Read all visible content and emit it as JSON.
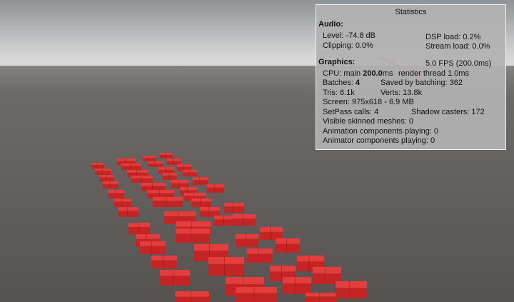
{
  "panel": {
    "title": "Statistics",
    "audio_header": "Audio:",
    "level": "Level: -74.8 dB",
    "clipping": "Clipping: 0.0%",
    "dsp_load": "DSP load: 0.2%",
    "stream_load": "Stream load: 0.0%",
    "fps": "5.0 FPS (200.0ms)",
    "graphics_header": "Graphics:",
    "cpu_prefix": "CPU: main ",
    "cpu_main": "200.0",
    "cpu_suffix": "ms",
    "render_thread": "render thread 1.0ms",
    "batches_prefix": "Batches: ",
    "batches": "4",
    "saved_batching": "Saved by batching: 362",
    "tris": "Tris: 6.1k",
    "verts": "Verts: 13.8k",
    "screen": "Screen: 975x618 - 6.9 MB",
    "setpass": "SetPass calls: 4",
    "shadow_casters": "Shadow casters: 172",
    "skinned": "Visible skinned meshes: 0",
    "animation": "Animation components playing: 0",
    "animator": "Animator components playing: 0"
  },
  "colors": {
    "sky_top": "#8e9396",
    "sky_horizon": "#d8d8d8",
    "ground": "#585553",
    "cube": "#d22a2a",
    "annotation_arrow": "#f03c2a"
  }
}
